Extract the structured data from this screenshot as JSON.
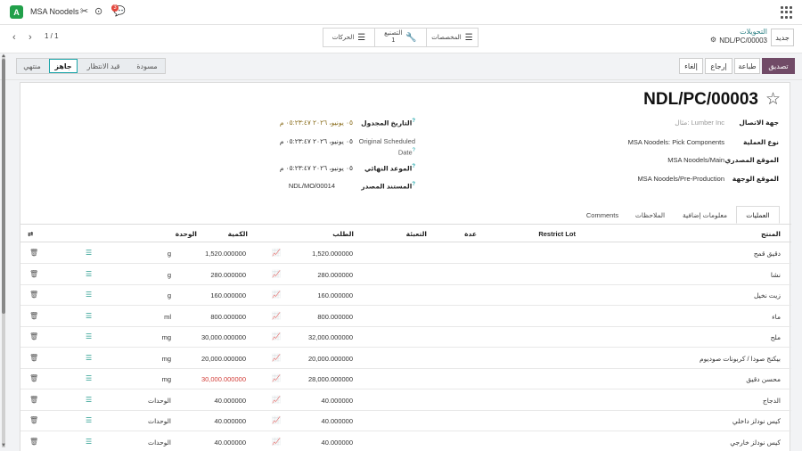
{
  "navbar": {
    "company_badge": "A",
    "company_name": "MSA Noodels",
    "chat_count": "3",
    "icons": [
      "debug-icon",
      "clock-icon",
      "chat-icon",
      "apps-grid-icon"
    ]
  },
  "control_panel": {
    "pager": "1 / 1",
    "new_button": "جديد",
    "breadcrumb_parent": "التحويلات",
    "breadcrumb_record": "NDL/PC/00003",
    "smart_buttons": [
      {
        "label": "المخصصات",
        "icon": "list-icon"
      },
      {
        "label": "التصنيع",
        "count": "1",
        "icon": "wrench-icon"
      },
      {
        "label": "الحركات",
        "icon": "list-icon"
      }
    ]
  },
  "status": {
    "actions": [
      "تصديق",
      "طباعة",
      "إرجاع",
      "إلغاء"
    ],
    "stages": [
      "منتهي",
      "جاهز",
      "قيد الانتظار",
      "مسودة"
    ],
    "active_stage": "جاهز"
  },
  "form": {
    "title": "NDL/PC/00003",
    "left_fields": [
      {
        "label": "جهة الاتصال",
        "value": "مثال: Lumber Inc",
        "placeholder": true
      },
      {
        "label": "نوع العملية",
        "value": "MSA Noodels: Pick Components"
      },
      {
        "label": "الموقع المصدري",
        "value": "MSA Noodels/Main"
      },
      {
        "label": "الموقع الوجهة",
        "value": "MSA Noodels/Pre-Production"
      }
    ],
    "right_fields": [
      {
        "label": "التاريخ المجدول",
        "value": "٠٥ يونيو، ٢٠٢٦ ٠٥:٢٣:٤٧ م",
        "help": "?"
      },
      {
        "label": "Original Scheduled Date",
        "value": "٠٥ يونيو، ٢٠٢٦ ٠٥:٢٣:٤٧ م",
        "help": "?"
      },
      {
        "label": "الموعد النهائي",
        "value": "٠٥ يونيو، ٢٠٢٦ ٠٥:٢٣:٤٧ م",
        "help": "?"
      },
      {
        "label": "المستند المصدر",
        "value": "NDL/MO/00014",
        "help": "?"
      }
    ]
  },
  "tabs": [
    "العمليات",
    "معلومات إضافية",
    "الملاحظات",
    "Comments"
  ],
  "active_tab": "العمليات",
  "table": {
    "headers": {
      "product": "المنتج",
      "restrict_lot": "Restrict Lot",
      "count": "عدة",
      "packaging": "التعبئة",
      "demand": "الطلب",
      "quantity": "الكمية",
      "unit": "الوحدة"
    },
    "rows": [
      {
        "product": "دقيق قمح",
        "demand": "1,520.000000",
        "quantity": "1,520.000000",
        "unit": "g",
        "short": false
      },
      {
        "product": "نشا",
        "demand": "280.000000",
        "quantity": "280.000000",
        "unit": "g",
        "short": false
      },
      {
        "product": "زيت نخيل",
        "demand": "160.000000",
        "quantity": "160.000000",
        "unit": "g",
        "short": false
      },
      {
        "product": "ماء",
        "demand": "800.000000",
        "quantity": "800.000000",
        "unit": "ml",
        "short": false
      },
      {
        "product": "ملح",
        "demand": "32,000.000000",
        "quantity": "30,000.000000",
        "unit": "mg",
        "short": false
      },
      {
        "product": "بيكنج صودا / كربونات صوديوم",
        "demand": "20,000.000000",
        "quantity": "20,000.000000",
        "unit": "mg",
        "short": false
      },
      {
        "product": "محسن دقيق",
        "demand": "28,000.000000",
        "quantity": "30,000.000000",
        "unit": "mg",
        "short": true
      },
      {
        "product": "الدجاج",
        "demand": "40.000000",
        "quantity": "40.000000",
        "unit": "الوحدات",
        "short": false
      },
      {
        "product": "كيس نودلز داخلي",
        "demand": "40.000000",
        "quantity": "40.000000",
        "unit": "الوحدات",
        "short": false
      },
      {
        "product": "كيس نودلز خارجي",
        "demand": "40.000000",
        "quantity": "40.000000",
        "unit": "الوحدات",
        "short": false
      }
    ]
  }
}
